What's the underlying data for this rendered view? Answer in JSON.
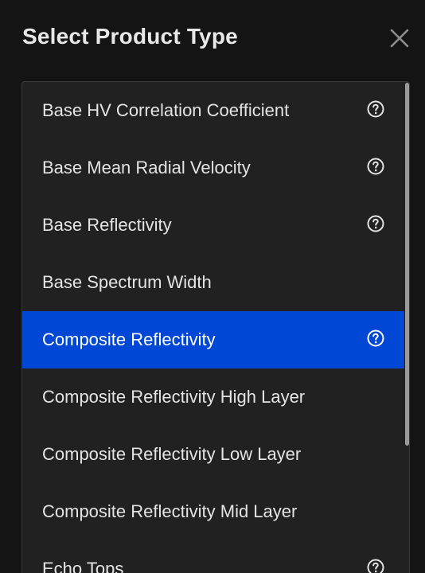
{
  "dialog": {
    "title": "Select Product Type",
    "close_icon": "close-icon"
  },
  "colors": {
    "background": "#141414",
    "panel": "#212121",
    "selected": "#0047d6",
    "text": "#e4e4e4"
  },
  "items": [
    {
      "label": "Base HV Correlation Coefficient",
      "help": true,
      "selected": false
    },
    {
      "label": "Base Mean Radial Velocity",
      "help": true,
      "selected": false
    },
    {
      "label": "Base Reflectivity",
      "help": true,
      "selected": false
    },
    {
      "label": "Base Spectrum Width",
      "help": false,
      "selected": false
    },
    {
      "label": "Composite Reflectivity",
      "help": true,
      "selected": true
    },
    {
      "label": "Composite Reflectivity High Layer",
      "help": false,
      "selected": false
    },
    {
      "label": "Composite Reflectivity Low Layer",
      "help": false,
      "selected": false
    },
    {
      "label": "Composite Reflectivity Mid Layer",
      "help": false,
      "selected": false
    },
    {
      "label": "Echo Tops",
      "help": true,
      "selected": false
    }
  ],
  "help_icon": "help-circle-icon"
}
